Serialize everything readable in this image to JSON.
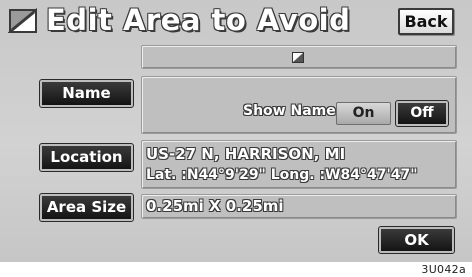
{
  "header": {
    "title": "Edit Area to Avoid",
    "back_label": "Back",
    "icon": "area-avoid-icon"
  },
  "area_header": {
    "icon": "avoid-area-marker-icon"
  },
  "name_row": {
    "button_label": "Name",
    "show_name_label": "Show Name",
    "on_label": "On",
    "off_label": "Off",
    "selected": "Off"
  },
  "location_row": {
    "button_label": "Location",
    "address": "US-27 N, HARRISON, MI",
    "coordinates": "Lat. :N44°9'29\"  Long. :W84°47'47\""
  },
  "area_size_row": {
    "button_label": "Area Size",
    "value": "0.25mi X 0.25mi"
  },
  "footer": {
    "ok_label": "OK",
    "image_code": "3U042a"
  }
}
